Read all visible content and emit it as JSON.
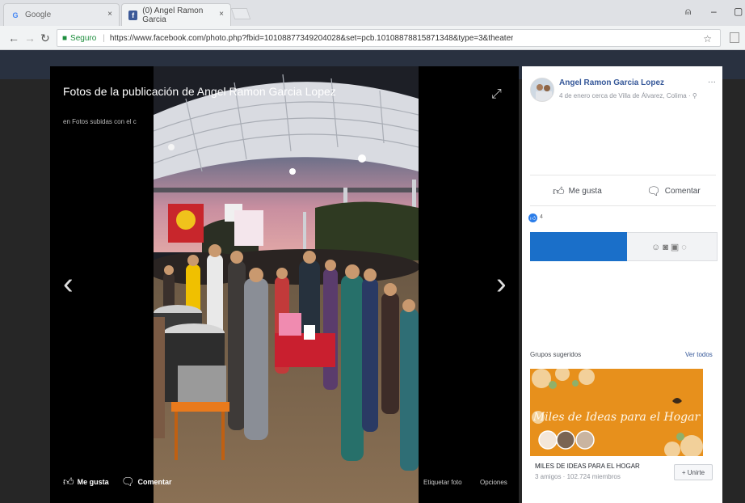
{
  "browser": {
    "tabs": [
      {
        "label": "Google",
        "favicon": "G"
      },
      {
        "label": "(0) Angel Ramon Garcia",
        "favicon": "f"
      }
    ],
    "secure_label": "Seguro",
    "url": "https://www.facebook.com/photo.php?fbid=10108877349204028&set=pcb.10108878815871348&type=3&theater"
  },
  "viewer": {
    "title": "Fotos de la publicación de Angel Ramon Garcia Lopez",
    "subtitle": "en Fotos subidas con el c",
    "like_label": "Me gusta",
    "comment_label": "Comentar",
    "tag_label": "Etiquetar foto",
    "options_label": "Opciones"
  },
  "post": {
    "author": "Angel Ramon Garcia Lopez",
    "meta": "4 de enero cerca de Villa de Álvarez, Colima · ",
    "like_label": "Me gusta",
    "comment_label": "Comentar",
    "reaction_count": "4"
  },
  "groups": {
    "heading": "Grupos sugeridos",
    "see_all": "Ver todos",
    "banner_text": "Miles de Ideas para el Hogar",
    "name": "MILES DE IDEAS PARA EL HOGAR",
    "stats": "3 amigos · 102.724 miembros",
    "join_label": "+ Unirte"
  },
  "colors": {
    "fb_blue": "#365899",
    "comment_bar": "#1a6fc9",
    "group_banner": "#e7901c"
  }
}
